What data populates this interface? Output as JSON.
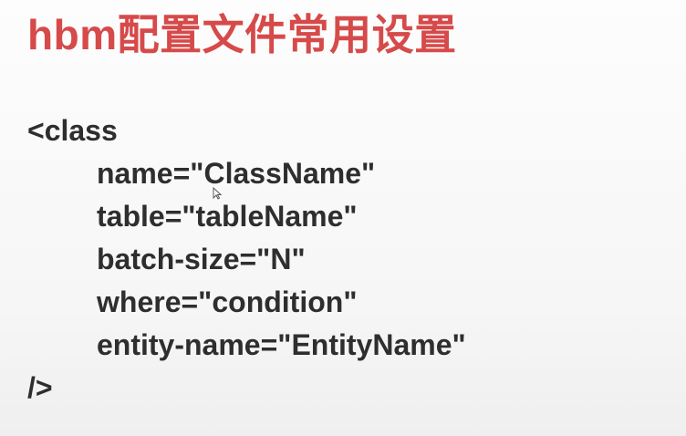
{
  "slide": {
    "title": "hbm配置文件常用设置",
    "lines": [
      "<class",
      "name=\"ClassName\"",
      "table=\"tableName\"",
      "batch-size=\"N\"",
      "where=\"condition\"",
      "entity-name=\"EntityName\"",
      "/>"
    ]
  },
  "colors": {
    "title": "#d64a4a",
    "code": "#2e2e2e",
    "background": "#f8f8f8"
  },
  "icons": {
    "cursor": "mouse-pointer-icon"
  }
}
